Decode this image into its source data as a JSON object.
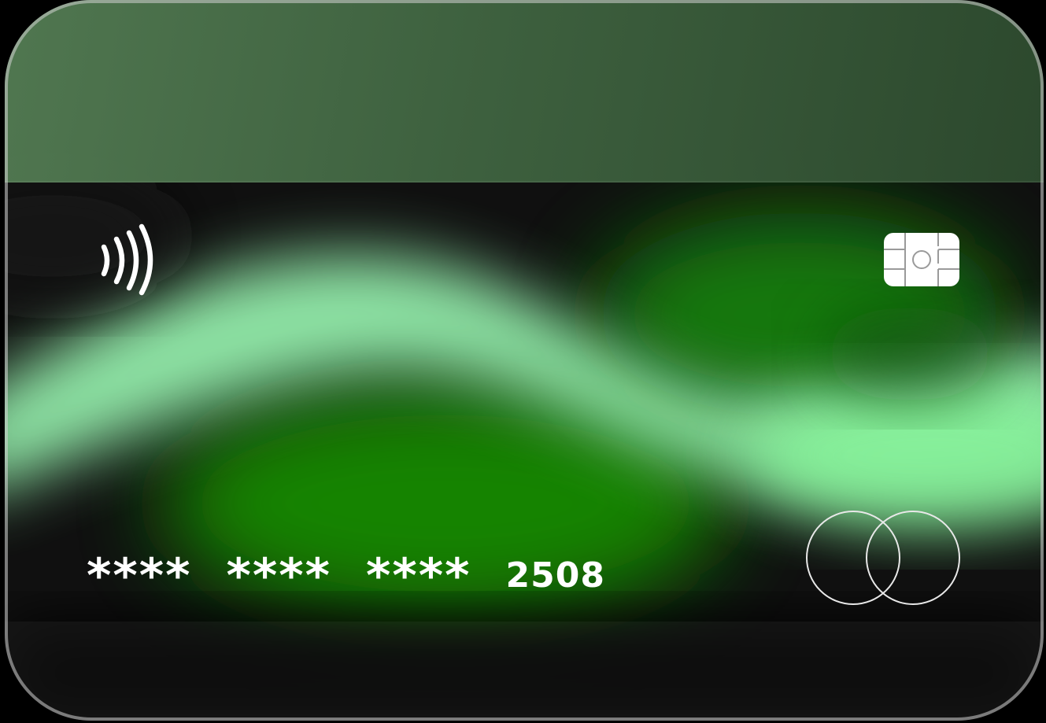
{
  "card": {
    "number_groups": [
      "****",
      "****",
      "****",
      "2508"
    ],
    "colors": {
      "background": "#0f0f0f",
      "top_band": "#44683f",
      "accent_green": "#1a8a0a",
      "light_green": "#9cf5b4",
      "text": "#ffffff"
    },
    "icons": {
      "contactless": "contactless-icon",
      "chip": "chip-icon",
      "brand": "mastercard-circles-logo"
    }
  }
}
